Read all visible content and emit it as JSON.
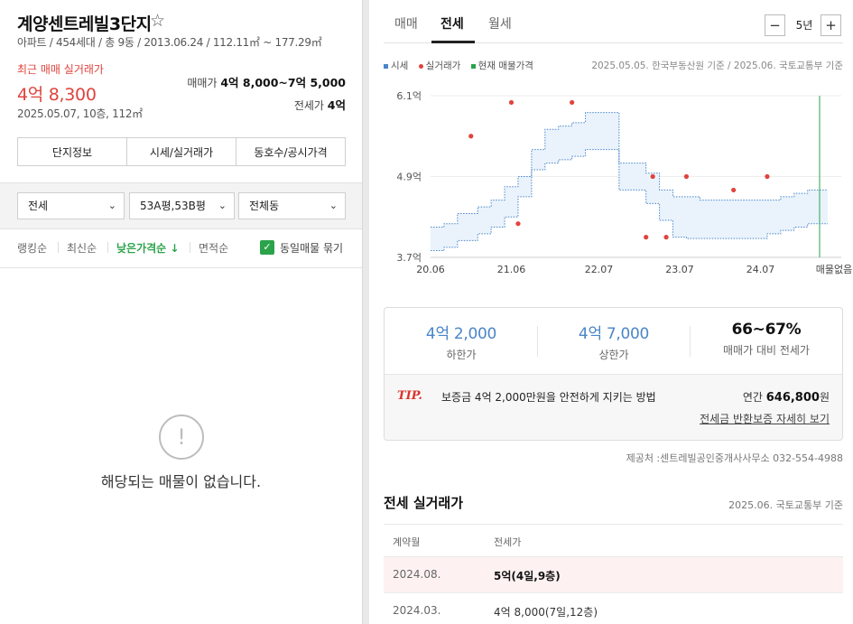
{
  "complex": {
    "name": "계양센트레빌3단지",
    "star": "☆",
    "info": "아파트 / 454세대 / 총 9동 / 2013.06.24 / 112.11㎡ ~ 177.29㎡",
    "recent_label": "최근 매매 실거래가",
    "recent_price": "4억 8,300",
    "recent_detail": "2025.05.07, 10층, 112㎡",
    "sale_label": "매매가",
    "sale_value": "4억 8,000~7억 5,000",
    "jeonse_label": "전세가",
    "jeonse_value": "4억"
  },
  "info_tabs": [
    "단지정보",
    "시세/실거래가",
    "동호수/공시가격"
  ],
  "filters": {
    "trade_type": "전세",
    "area": "53A평,53B평",
    "dong": "전체동"
  },
  "sort": {
    "options": [
      "랭킹순",
      "최신순",
      "낮은가격순",
      "면적순"
    ],
    "active_index": 2,
    "active_arrow": "↓",
    "checkbox_label": "동일매물 묶기",
    "checkbox_checked": true
  },
  "empty": {
    "icon": "!",
    "message": "해당되는 매물이 없습니다."
  },
  "chart_tabs": [
    "매매",
    "전세",
    "월세"
  ],
  "chart_tab_active": 1,
  "period": {
    "minus": "−",
    "value": "5년",
    "plus": "+"
  },
  "legend": {
    "items": [
      {
        "label": "시세",
        "color": "#4a86c8"
      },
      {
        "label": "실거래가",
        "color": "#e0433d"
      },
      {
        "label": "현재 매물가격",
        "color": "#2ba34a"
      }
    ],
    "source": "2025.05.05. 한국부동산원 기준 / 2025.06. 국토교통부 기준"
  },
  "chart_data": {
    "type": "line",
    "y_ticks": [
      "6.1억",
      "4.9억",
      "3.7억"
    ],
    "ylim": [
      3.7,
      6.1
    ],
    "x_ticks": [
      "20.06",
      "21.06",
      "22.07",
      "23.07",
      "24.07"
    ],
    "x_end_label": "매물없음",
    "series": [
      {
        "name": "시세",
        "x": [
          "2020-06",
          "2020-08",
          "2020-10",
          "2021-01",
          "2021-03",
          "2021-05",
          "2021-07",
          "2021-09",
          "2021-11",
          "2022-01",
          "2022-03",
          "2022-05",
          "2022-07",
          "2022-09",
          "2022-10",
          "2022-12",
          "2023-02",
          "2023-04",
          "2023-06",
          "2023-08",
          "2023-10",
          "2023-12",
          "2024-02",
          "2024-04",
          "2024-06",
          "2024-08",
          "2024-10",
          "2024-12",
          "2025-02",
          "2025-05"
        ],
        "upper": [
          4.15,
          4.2,
          4.35,
          4.45,
          4.55,
          4.75,
          4.9,
          5.3,
          5.6,
          5.65,
          5.7,
          5.85,
          5.85,
          5.85,
          5.1,
          5.1,
          4.95,
          4.7,
          4.6,
          4.6,
          4.55,
          4.55,
          4.55,
          4.55,
          4.55,
          4.55,
          4.6,
          4.65,
          4.7,
          4.7
        ],
        "lower": [
          3.8,
          3.85,
          3.95,
          4.05,
          4.15,
          4.3,
          4.6,
          5.0,
          5.1,
          5.15,
          5.2,
          5.3,
          5.3,
          5.3,
          4.7,
          4.7,
          4.5,
          4.25,
          4.0,
          3.98,
          3.98,
          3.98,
          3.98,
          3.98,
          3.98,
          4.05,
          4.1,
          4.15,
          4.2,
          4.2
        ]
      },
      {
        "name": "실거래가",
        "x": [
          "2020-12",
          "2021-06",
          "2021-07",
          "2022-03",
          "2023-02",
          "2023-03",
          "2023-05",
          "2023-08",
          "2024-03",
          "2024-08"
        ],
        "y": [
          5.5,
          6.0,
          4.2,
          6.0,
          4.0,
          4.9,
          4.0,
          4.9,
          4.7,
          4.9
        ]
      }
    ]
  },
  "summary": {
    "lower_value": "4억 2,000",
    "lower_label": "하한가",
    "upper_value": "4억 7,000",
    "upper_label": "상한가",
    "ratio_value": "66~67%",
    "ratio_label": "매매가 대비 전세가",
    "tip_badge": "TIP.",
    "tip_text": "보증금 4억 2,000만원을 안전하게 지키는 방법",
    "annual_label": "연간",
    "annual_value": "646,800",
    "annual_unit": "원",
    "guarantee_link": "전세금 반환보증 자세히 보기"
  },
  "provider": "제공처 :센트레빌공인중개사사무소 032-554-4988",
  "transactions": {
    "title": "전세 실거래가",
    "source": "2025.06. 국토교통부 기준",
    "headers": [
      "계약월",
      "전세가"
    ],
    "rows": [
      {
        "month": "2024.08.",
        "price": "5억(4일,9층)"
      },
      {
        "month": "2024.03.",
        "price": "4억 8,000(7일,12층)"
      }
    ]
  }
}
